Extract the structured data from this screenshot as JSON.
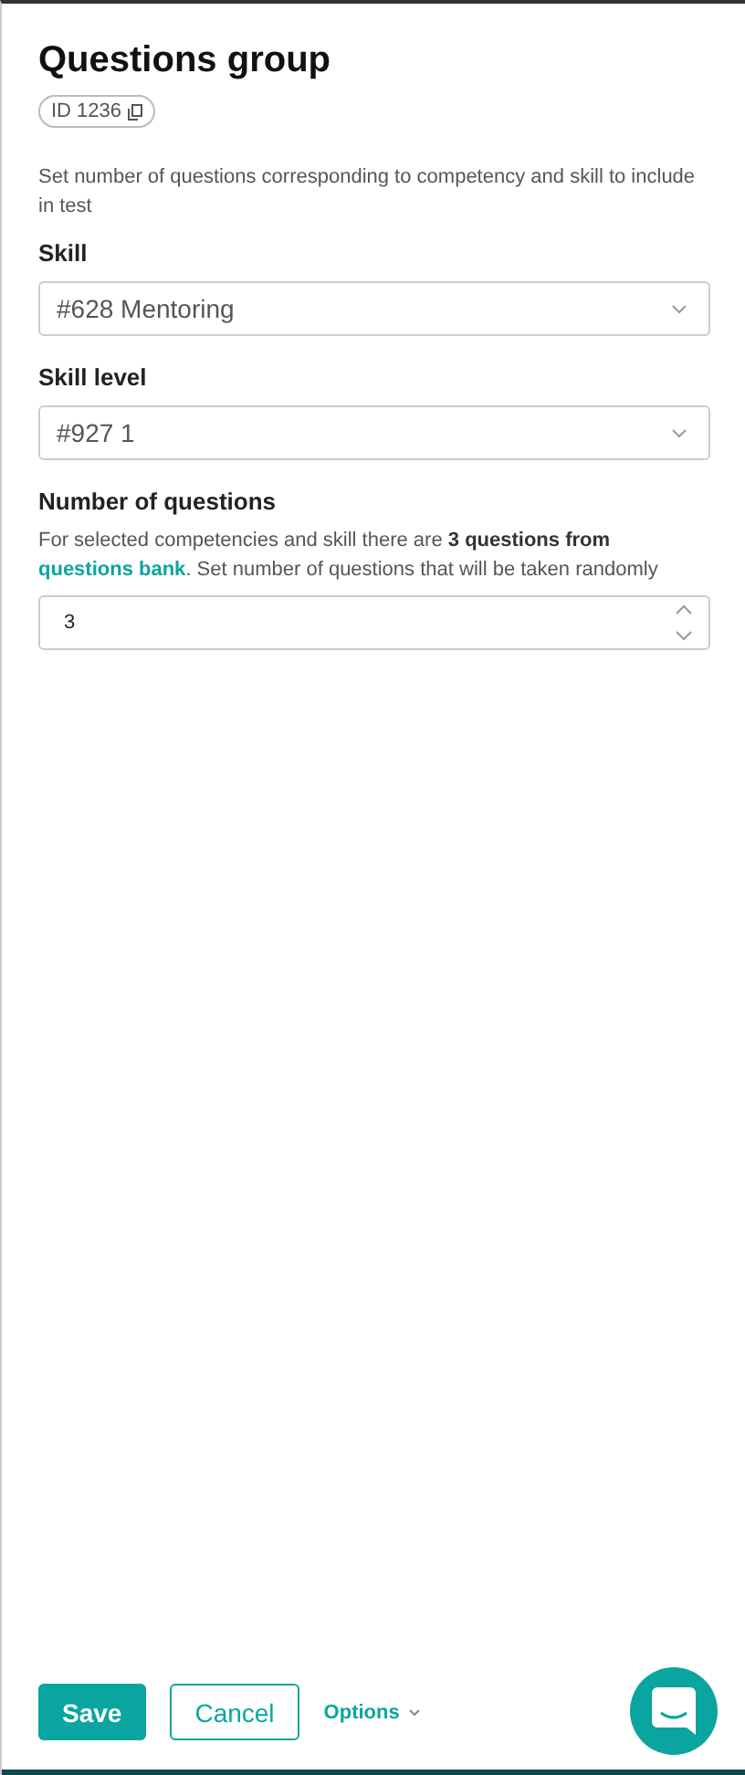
{
  "title": "Questions group",
  "id_badge": "ID 1236",
  "description": "Set number of questions corresponding to competency and skill to include in test",
  "fields": [
    {
      "kind": "select",
      "label": "Skill",
      "value": "#628 Mentoring"
    },
    {
      "kind": "select",
      "label": "Skill level",
      "value": "#927 1"
    },
    {
      "kind": "number",
      "label": "Number of questions",
      "hint_before": "For selected competencies and skill there are **3 questions from**",
      "hint_link": "questions bank",
      "hint_after": ". Set number of questions that will be taken randomly",
      "value": "3"
    }
  ],
  "buttons": {
    "save": "Save",
    "cancel": "Cancel",
    "options": "Options"
  }
}
